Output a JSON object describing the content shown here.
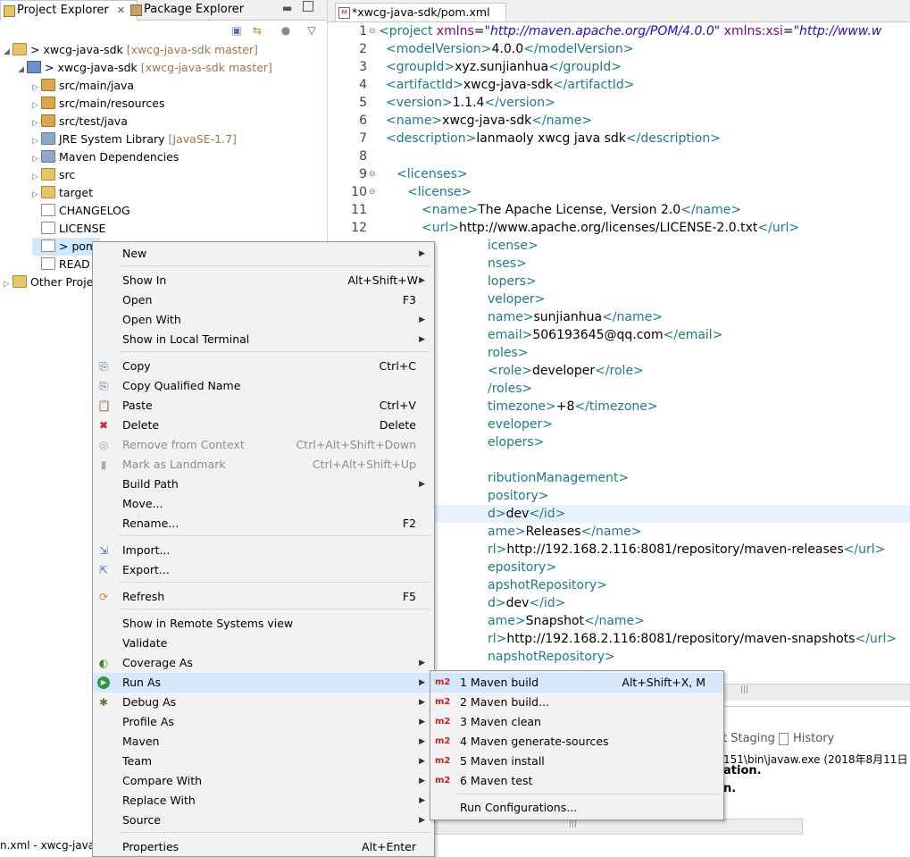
{
  "left_tabs": {
    "project_explorer": "Project Explorer",
    "package_explorer": "Package Explorer"
  },
  "tree": {
    "root_project": "> xwcg-java-sdk",
    "root_project_deco": "[xwcg-java-sdk master]",
    "sub_project": "> xwcg-java-sdk",
    "sub_project_deco": "[xwcg-java-sdk master]",
    "items": [
      {
        "label": "src/main/java",
        "deco": ""
      },
      {
        "label": "src/main/resources",
        "deco": ""
      },
      {
        "label": "src/test/java",
        "deco": ""
      },
      {
        "label": "JRE System Library",
        "deco": "[JavaSE-1.7]"
      },
      {
        "label": "Maven Dependencies",
        "deco": ""
      },
      {
        "label": "src",
        "deco": ""
      },
      {
        "label": "target",
        "deco": ""
      },
      {
        "label": "CHANGELOG",
        "deco": ""
      },
      {
        "label": "LICENSE",
        "deco": ""
      },
      {
        "label": "> pom",
        "deco": ""
      },
      {
        "label": "READ",
        "deco": ""
      }
    ],
    "other_projects": "Other Proje"
  },
  "editor": {
    "tab_label": "*xwcg-java-sdk/pom.xml"
  },
  "code": {
    "l1_tag": "<project",
    "l1_attr1": "xmlns",
    "l1_val1": "\"http://maven.apache.org/POM/4.0.0\"",
    "l1_attr2": "xmlns:xsi",
    "l1_val2": "\"http://www.w",
    "l2_open": "<modelVersion>",
    "l2_text": "4.0.0",
    "l2_close": "</modelVersion>",
    "l3_open": "<groupId>",
    "l3_text": "xyz.sunjianhua",
    "l3_close": "</groupId>",
    "l4_open": "<artifactId>",
    "l4_text": "xwcg-java-sdk",
    "l4_close": "</artifactId>",
    "l5_open": "<version>",
    "l5_text": "1.1.4",
    "l5_close": "</version>",
    "l6_open": "<name>",
    "l6_text": "xwcg-java-sdk",
    "l6_close": "</name>",
    "l7_open": "<description>",
    "l7_text": "lanmaoly xwcg java sdk",
    "l7_close": "</description>",
    "l9": "<licenses>",
    "l10": "<license>",
    "l11_open": "<name>",
    "l11_text": "The Apache License, Version 2.0",
    "l11_close": "</name>",
    "l12_open": "<url>",
    "l12_text": "http://www.apache.org/licenses/LICENSE-2.0.txt",
    "l12_close": "</url>",
    "l13": "icense>",
    "l14": "nses>",
    "l15": "lopers>",
    "l16": "veloper>",
    "l17_open": "name>",
    "l17_text": "sunjianhua",
    "l17_close": "</name>",
    "l18_open": "email>",
    "l18_text": "506193645@qq.com",
    "l18_close": "</email>",
    "l19": "roles>",
    "l20_open": "<role>",
    "l20_text": "developer",
    "l20_close": "</role>",
    "l21": "/roles>",
    "l22_open": "timezone>",
    "l22_text": "+8",
    "l22_close": "</timezone>",
    "l23": "eveloper>",
    "l24": "elopers>",
    "l26": "ributionManagement>",
    "l27": "pository>",
    "l28_open": "d>",
    "l28_text": "dev",
    "l28_close": "</id>",
    "l29_open": "ame>",
    "l29_text": "Releases",
    "l29_close": "</name>",
    "l30_open": "rl>",
    "l30_text": "http://192.168.2.116:8081/repository/maven-releases",
    "l30_close": "</url>",
    "l31": "epository>",
    "l32": "apshotRepository>",
    "l33_open": "d>",
    "l33_text": "dev",
    "l33_close": "</id>",
    "l34_open": "ame>",
    "l34_text": "Snapshot",
    "l34_close": "</name>",
    "l35_open": "rl>",
    "l35_text": "http://192.168.2.116:8081/repository/maven-snapshots",
    "l35_close": "</url>",
    "l36": "napshotRepository>"
  },
  "line_numbers": [
    "1",
    "2",
    "3",
    "4",
    "5",
    "6",
    "7",
    "8",
    "9",
    "10",
    "11",
    "12"
  ],
  "bottom": {
    "staging_tab": "t Staging",
    "history_tab": "History",
    "console_path": "151\\bin\\javaw.exe (2018年8月11日 上",
    "console_l1": "ation.",
    "console_l2": "n.",
    "status_file": "n.xml - xwcg-java-"
  },
  "context_menu": {
    "items": [
      {
        "label": "New",
        "shortcut": "",
        "sub": true
      },
      {
        "label": "Show In",
        "shortcut": "Alt+Shift+W",
        "sub": true
      },
      {
        "label": "Open",
        "shortcut": "F3",
        "sub": false
      },
      {
        "label": "Open With",
        "shortcut": "",
        "sub": true
      },
      {
        "label": "Show in Local Terminal",
        "shortcut": "",
        "sub": true
      },
      {
        "label": "Copy",
        "shortcut": "Ctrl+C",
        "sub": false
      },
      {
        "label": "Copy Qualified Name",
        "shortcut": "",
        "sub": false
      },
      {
        "label": "Paste",
        "shortcut": "Ctrl+V",
        "sub": false
      },
      {
        "label": "Delete",
        "shortcut": "Delete",
        "sub": false
      },
      {
        "label": "Remove from Context",
        "shortcut": "Ctrl+Alt+Shift+Down",
        "sub": false
      },
      {
        "label": "Mark as Landmark",
        "shortcut": "Ctrl+Alt+Shift+Up",
        "sub": false
      },
      {
        "label": "Build Path",
        "shortcut": "",
        "sub": true
      },
      {
        "label": "Move...",
        "shortcut": "",
        "sub": false
      },
      {
        "label": "Rename...",
        "shortcut": "F2",
        "sub": false
      },
      {
        "label": "Import...",
        "shortcut": "",
        "sub": false
      },
      {
        "label": "Export...",
        "shortcut": "",
        "sub": false
      },
      {
        "label": "Refresh",
        "shortcut": "F5",
        "sub": false
      },
      {
        "label": "Show in Remote Systems view",
        "shortcut": "",
        "sub": false
      },
      {
        "label": "Validate",
        "shortcut": "",
        "sub": false
      },
      {
        "label": "Coverage As",
        "shortcut": "",
        "sub": true
      },
      {
        "label": "Run As",
        "shortcut": "",
        "sub": true
      },
      {
        "label": "Debug As",
        "shortcut": "",
        "sub": true
      },
      {
        "label": "Profile As",
        "shortcut": "",
        "sub": true
      },
      {
        "label": "Maven",
        "shortcut": "",
        "sub": true
      },
      {
        "label": "Team",
        "shortcut": "",
        "sub": true
      },
      {
        "label": "Compare With",
        "shortcut": "",
        "sub": true
      },
      {
        "label": "Replace With",
        "shortcut": "",
        "sub": true
      },
      {
        "label": "Source",
        "shortcut": "",
        "sub": true
      },
      {
        "label": "Properties",
        "shortcut": "Alt+Enter",
        "sub": false
      }
    ]
  },
  "run_as_menu": {
    "items": [
      {
        "label": "1 Maven build",
        "shortcut": "Alt+Shift+X, M"
      },
      {
        "label": "2 Maven build...",
        "shortcut": ""
      },
      {
        "label": "3 Maven clean",
        "shortcut": ""
      },
      {
        "label": "4 Maven generate-sources",
        "shortcut": ""
      },
      {
        "label": "5 Maven install",
        "shortcut": ""
      },
      {
        "label": "6 Maven test",
        "shortcut": ""
      },
      {
        "label": "Run Configurations...",
        "shortcut": ""
      }
    ],
    "icon_text": "m2"
  }
}
